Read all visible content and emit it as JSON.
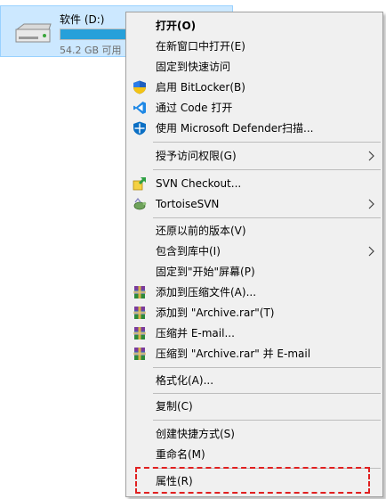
{
  "drive": {
    "name": "软件 (D:)",
    "free_text": "54.2 GB 可用",
    "used_fraction": 0.79,
    "icon": "hard-drive-icon"
  },
  "menu": {
    "items": [
      {
        "label": "打开(O)",
        "bold": true,
        "icon": ""
      },
      {
        "label": "在新窗口中打开(E)",
        "icon": ""
      },
      {
        "label": "固定到快速访问",
        "icon": ""
      },
      {
        "label": "启用 BitLocker(B)",
        "icon": "shield-icon"
      },
      {
        "label": "通过 Code 打开",
        "icon": "vscode-icon"
      },
      {
        "label": "使用 Microsoft Defender扫描...",
        "icon": "defender-icon"
      },
      {
        "label": "授予访问权限(G)",
        "icon": "",
        "submenu": true
      },
      {
        "label": "SVN Checkout...",
        "icon": "svn-checkout-icon"
      },
      {
        "label": "TortoiseSVN",
        "icon": "tortoisesvn-icon",
        "submenu": true
      },
      {
        "label": "还原以前的版本(V)",
        "icon": ""
      },
      {
        "label": "包含到库中(I)",
        "icon": "",
        "submenu": true
      },
      {
        "label": "固定到\"开始\"屏幕(P)",
        "icon": ""
      },
      {
        "label": "添加到压缩文件(A)...",
        "icon": "winrar-icon"
      },
      {
        "label": "添加到 \"Archive.rar\"(T)",
        "icon": "winrar-icon"
      },
      {
        "label": "压缩并 E-mail...",
        "icon": "winrar-icon"
      },
      {
        "label": "压缩到 \"Archive.rar\" 并 E-mail",
        "icon": "winrar-icon"
      },
      {
        "label": "格式化(A)...",
        "icon": ""
      },
      {
        "label": "复制(C)",
        "icon": ""
      },
      {
        "label": "创建快捷方式(S)",
        "icon": ""
      },
      {
        "label": "重命名(M)",
        "icon": ""
      },
      {
        "label": "属性(R)",
        "icon": "",
        "highlighted": true
      }
    ]
  },
  "colors": {
    "selection_bg": "#cce8ff",
    "menu_bg": "#f0f0f0",
    "highlight_border": "#e02020",
    "progress_fill": "#26a0da"
  }
}
